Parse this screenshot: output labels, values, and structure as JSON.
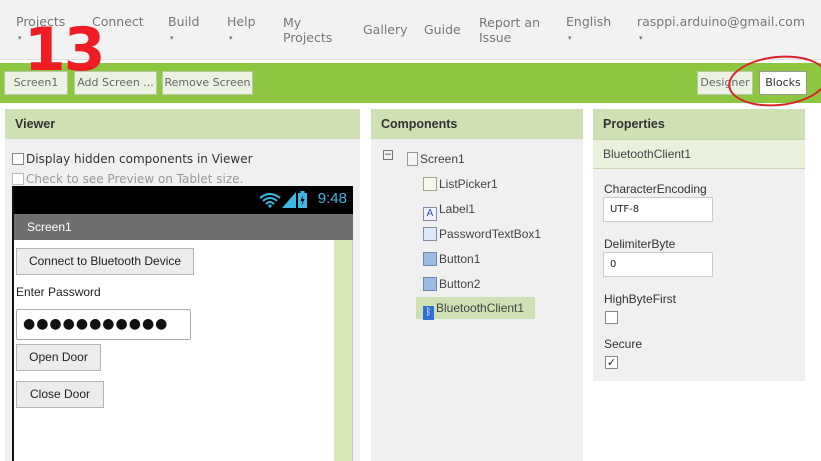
{
  "nav": {
    "items": [
      {
        "label": "Projects",
        "caret": "▾"
      },
      {
        "label": "Connect",
        "caret": "▾"
      },
      {
        "label": "Build",
        "caret": "▾"
      },
      {
        "label": "Help",
        "caret": "▾"
      },
      {
        "label": "My\nProjects"
      },
      {
        "label": "Gallery"
      },
      {
        "label": "Guide"
      },
      {
        "label": "Report an\nIssue"
      },
      {
        "label": "English",
        "caret": "▾"
      },
      {
        "label": "rasppi.arduino@gmail.com",
        "caret": "▾"
      }
    ],
    "overlay_number": "13"
  },
  "toolbar": {
    "screen_button": "Screen1",
    "add_screen_button": "Add Screen ...",
    "remove_screen_button": "Remove Screen",
    "designer_button": "Designer",
    "blocks_button": "Blocks"
  },
  "viewer": {
    "title": "Viewer",
    "display_hidden": "Display hidden components in Viewer",
    "tablet_preview": "Check to see Preview on Tablet size.",
    "phone": {
      "time": "9:48",
      "screen_title": "Screen1",
      "connect_button": "Connect to Bluetooth Device",
      "password_label": "Enter Password",
      "password_value": "●●●●●●●●●●●",
      "open_button": "Open Door",
      "close_button": "Close Door"
    }
  },
  "components": {
    "title": "Components",
    "root": "Screen1",
    "children": [
      "ListPicker1",
      "Label1",
      "PasswordTextBox1",
      "Button1",
      "Button2",
      "BluetoothClient1"
    ],
    "selected": "BluetoothClient1"
  },
  "properties": {
    "title": "Properties",
    "component": "BluetoothClient1",
    "character_encoding_label": "CharacterEncoding",
    "character_encoding_value": "UTF-8",
    "delimiter_byte_label": "DelimiterByte",
    "delimiter_byte_value": "0",
    "high_byte_first_label": "HighByteFirst",
    "high_byte_first_checked": false,
    "secure_label": "Secure",
    "secure_checked": true
  },
  "colors": {
    "toolbar_green": "#8dc63f",
    "panel_header": "#cfe0b3",
    "overlay_red": "#ef1c24",
    "clock_blue": "#3fb7e5"
  }
}
